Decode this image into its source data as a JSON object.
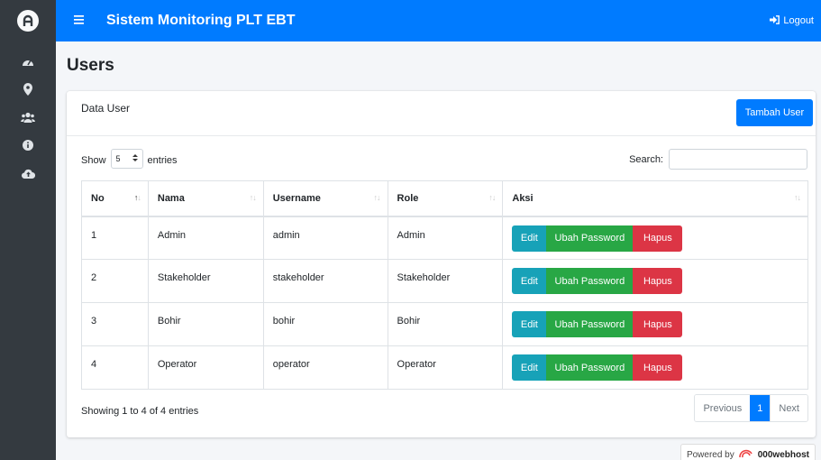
{
  "navbar": {
    "title": "Sistem Monitoring PLT EBT",
    "logout": "Logout"
  },
  "page": {
    "title": "Users"
  },
  "card": {
    "title": "Data User",
    "add_button": "Tambah User"
  },
  "controls": {
    "show_label": "Show",
    "entries_value": "5",
    "entries_label": "entries",
    "search_label": "Search:",
    "search_value": ""
  },
  "table": {
    "headers": [
      "No",
      "Nama",
      "Username",
      "Role",
      "Aksi"
    ],
    "rows": [
      {
        "no": "1",
        "nama": "Admin",
        "username": "admin",
        "role": "Admin"
      },
      {
        "no": "2",
        "nama": "Stakeholder",
        "username": "stakeholder",
        "role": "Stakeholder"
      },
      {
        "no": "3",
        "nama": "Bohir",
        "username": "bohir",
        "role": "Bohir"
      },
      {
        "no": "4",
        "nama": "Operator",
        "username": "operator",
        "role": "Operator"
      }
    ],
    "actions": {
      "edit": "Edit",
      "change_password": "Ubah Password",
      "delete": "Hapus"
    }
  },
  "footer": {
    "info": "Showing 1 to 4 of 4 entries",
    "previous": "Previous",
    "current_page": "1",
    "next": "Next"
  },
  "powered": {
    "by": "Powered by",
    "brand": "000webhost"
  },
  "sidebar": {
    "items": [
      "dashboard-icon",
      "location-icon",
      "users-icon",
      "info-icon",
      "cloud-upload-icon"
    ]
  },
  "colors": {
    "primary": "#007bff",
    "sidebar": "#343a40",
    "info": "#17a2b8",
    "success": "#28a745",
    "danger": "#dc3545"
  }
}
